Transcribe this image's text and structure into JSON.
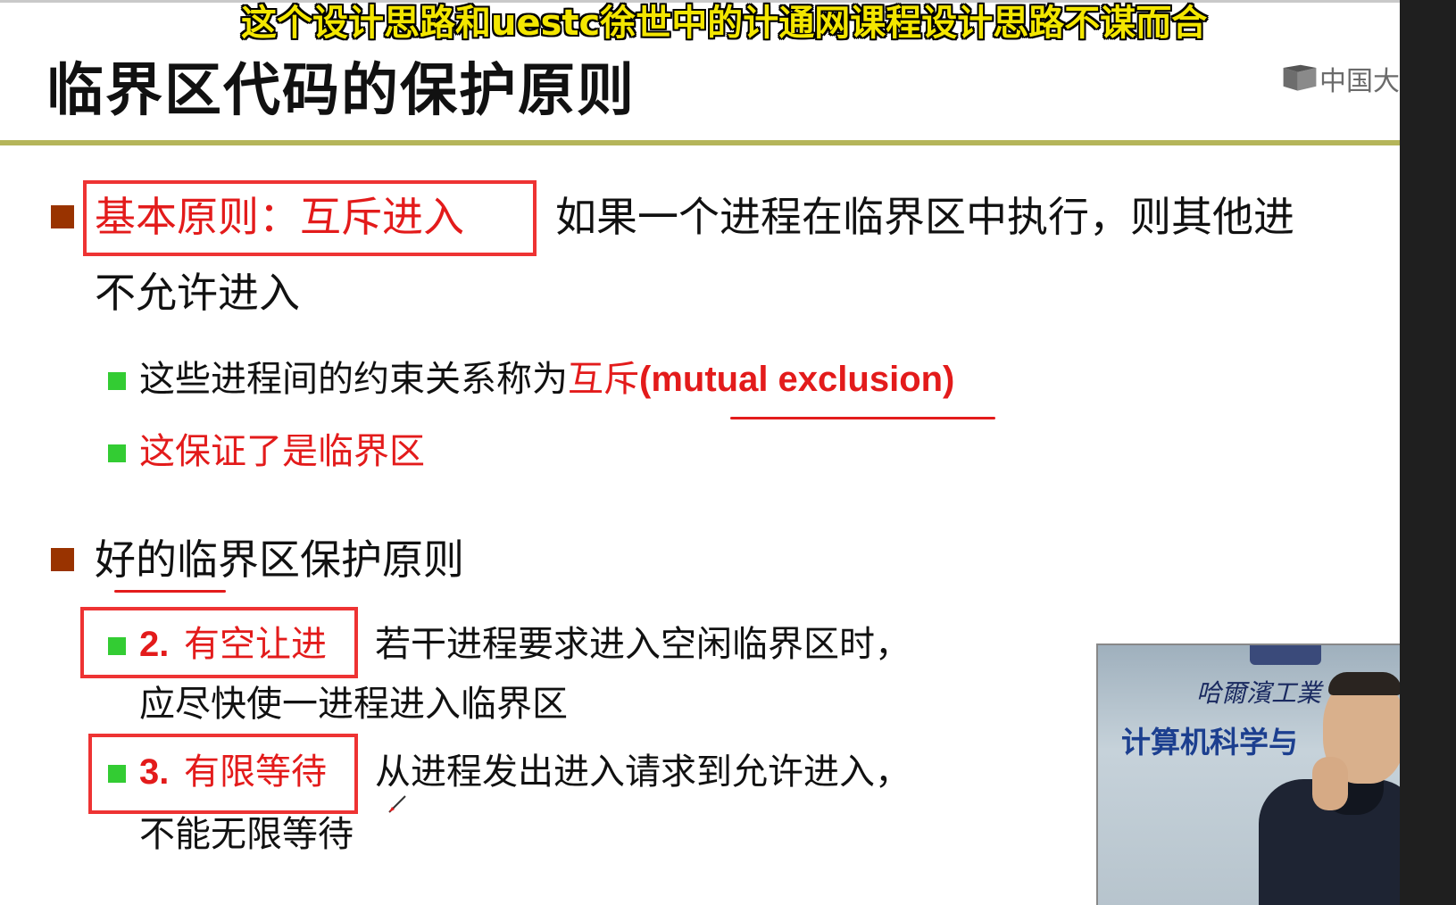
{
  "overlay_caption": "这个设计思路和uestc徐世中的计通网课程设计思路不谋而合",
  "slide": {
    "title": "临界区代码的保护原则",
    "logo_text": "中国大",
    "bullet1": {
      "label": "基本原则：互斥进入",
      "text_line1": "如果一个进程在临界区中执行，则其他进",
      "text_line2": "不允许进入"
    },
    "sub1": {
      "text": "这些进程间的约束关系称为",
      "red_term": "互斥",
      "english": "(mutual exclusion)"
    },
    "sub2": {
      "text": "这保证了是临界区"
    },
    "bullet2": {
      "text": "好的临界区保护原则"
    },
    "item2": {
      "number": "2.",
      "label": "有空让进",
      "text_line1": "若干进程要求进入空闲临界区时，",
      "text_line2": "应尽快使一进程进入临界区"
    },
    "item3": {
      "number": "3.",
      "label": "有限等待",
      "text_line1": "从进程发出进入请求到允许进入，",
      "text_line2": "不能无限等待"
    }
  },
  "video_overlay": {
    "school": "哈爾濱工業",
    "dept": "计算机科学与"
  },
  "colors": {
    "bullet_brown": "#993300",
    "bullet_green": "#33cc33",
    "highlight_red": "#e31b1b",
    "caption_yellow": "#f3e600",
    "title_rule": "#b5b55a"
  }
}
